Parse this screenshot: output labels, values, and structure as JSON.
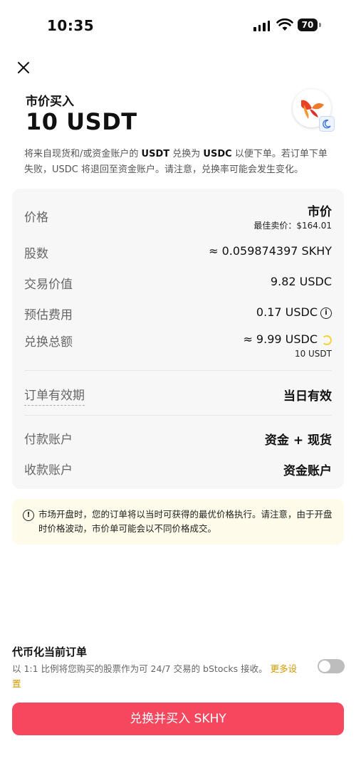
{
  "status_bar": {
    "time": "10:35",
    "battery": "70"
  },
  "header": {
    "subtitle": "市价买入",
    "amount": "10 USDT",
    "description_prefix": "将来自现货和/或资金账户的",
    "description_from": "USDT",
    "description_mid": "兑换为",
    "description_to": "USDC",
    "description_suffix": "以便下单。若订单下单失败，USDC 将退回至资金账户。请注意，兑换率可能会发生变化。"
  },
  "details": {
    "price_label": "价格",
    "price_value": "市价",
    "best_ask_label": "最佳卖价：",
    "best_ask_value": "$164.01",
    "shares_label": "股数",
    "shares_value": "≈ 0.059874397 SKHY",
    "trade_value_label": "交易价值",
    "trade_value": "9.82 USDC",
    "fee_label": "预估费用",
    "fee_value": "0.17 USDC",
    "convert_total_label": "兑换总额",
    "convert_total_value": "≈ 9.99 USDC",
    "convert_total_sub": "10 USDT",
    "validity_label": "订单有效期",
    "validity_value": "当日有效",
    "pay_account_label": "付款账户",
    "pay_account_value": "资金 + 现货",
    "receive_account_label": "收款账户",
    "receive_account_value": "资金账户"
  },
  "notice": {
    "text": "市场开盘时，您的订单将以当时可获得的最优价格执行。请注意，由于开盘时价格波动，市价单可能会以不同价格成交。"
  },
  "tokenize": {
    "title": "代币化当前订单",
    "description": "以 1:1 比例将您购买的股票作为可 24/7 交易的 bStocks 接收。",
    "more_link": "更多设置",
    "toggle_on": false
  },
  "submit_label": "兑换并买入 SKHY",
  "colors": {
    "accent": "#f5485e",
    "notice_bg": "#fffbea",
    "link": "#d19a00"
  }
}
